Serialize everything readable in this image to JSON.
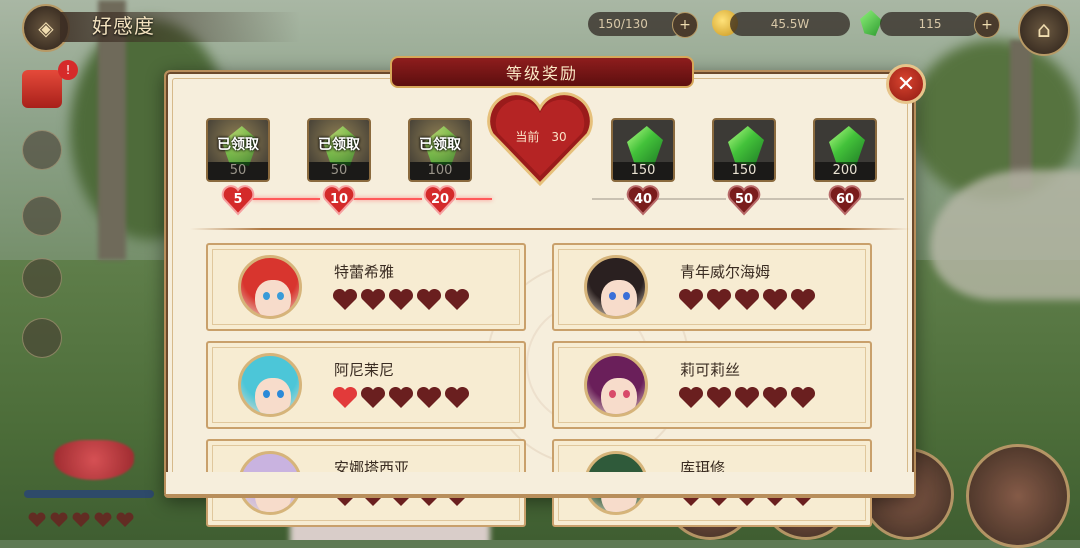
{
  "hud": {
    "title": "好感度",
    "stamina": "150/130",
    "coins": "45.5W",
    "gems": "115"
  },
  "dialog": {
    "title": "等级奖励",
    "current_label": "当前",
    "current_value": "30"
  },
  "rewards": [
    {
      "amount": "50",
      "level": "5",
      "claimed": true,
      "claimed_label": "已领取"
    },
    {
      "amount": "50",
      "level": "10",
      "claimed": true,
      "claimed_label": "已领取"
    },
    {
      "amount": "100",
      "level": "20",
      "claimed": true,
      "claimed_label": "已领取"
    },
    {
      "amount": "150",
      "level": "40",
      "claimed": false
    },
    {
      "amount": "150",
      "level": "50",
      "claimed": false
    },
    {
      "amount": "200",
      "level": "60",
      "claimed": false
    }
  ],
  "characters": [
    {
      "name": "特蕾希雅",
      "hearts_filled": 5,
      "hearts_total": 5,
      "hair": "#d8352e",
      "eyes": "#3a9bd8"
    },
    {
      "name": "青年威尔海姆",
      "hearts_filled": 5,
      "hearts_total": 5,
      "hair": "#2a2020",
      "eyes": "#3a6fd8"
    },
    {
      "name": "阿尼茉尼",
      "hearts_filled": 5,
      "hearts_total": 5,
      "hair": "#4cc6d8",
      "eyes": "#2b8ad8",
      "first_heart_bright": true
    },
    {
      "name": "莉可莉丝",
      "hearts_filled": 5,
      "hearts_total": 5,
      "hair": "#6a1f5a",
      "eyes": "#d84a6a"
    },
    {
      "name": "安娜塔西亚",
      "hearts_filled": 0,
      "hearts_total": 5,
      "hair": "#c9b3e0",
      "eyes": "#7a5ad8"
    },
    {
      "name": "库珥修",
      "hearts_filled": 0,
      "hearts_total": 5,
      "hair": "#2f5a3a",
      "eyes": "#4a8a5a"
    }
  ],
  "colors": {
    "heart_dark": "#6a1f1f",
    "heart_bright": "#e23a3a",
    "track_active": "#ff5a5a",
    "title_plate": "#7a1616"
  }
}
